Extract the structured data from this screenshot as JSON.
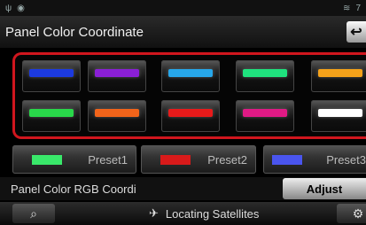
{
  "status": {
    "left_icons": [
      "signal-icon",
      "location-icon"
    ],
    "right_icons": [
      "wifi-icon"
    ],
    "right_text": "7"
  },
  "header": {
    "title": "Panel Color Coordinate",
    "back_icon": "return-icon"
  },
  "swatches": [
    {
      "color": "#1c3ae0"
    },
    {
      "color": "#8a1fd6"
    },
    {
      "color": "#27a7ea"
    },
    {
      "color": "#1fe27e"
    },
    {
      "color": "#f5a21a"
    },
    {
      "color": "#29d84a"
    },
    {
      "color": "#f2641a"
    },
    {
      "color": "#e81a1a"
    },
    {
      "color": "#e01a85"
    },
    {
      "color": "#ffffff"
    }
  ],
  "presets": [
    {
      "label": "Preset1",
      "color": "#39e86a"
    },
    {
      "label": "Preset2",
      "color": "#d81a1a"
    },
    {
      "label": "Preset3",
      "color": "#4a55ee"
    }
  ],
  "rgb": {
    "label": "Panel Color RGB Coordi",
    "button": "Adjust"
  },
  "footer": {
    "gps_text": "Locating Satellites",
    "left_icon": "camera-search-icon",
    "gps_icon": "satellite-icon",
    "right_icon": "gear-icon"
  }
}
